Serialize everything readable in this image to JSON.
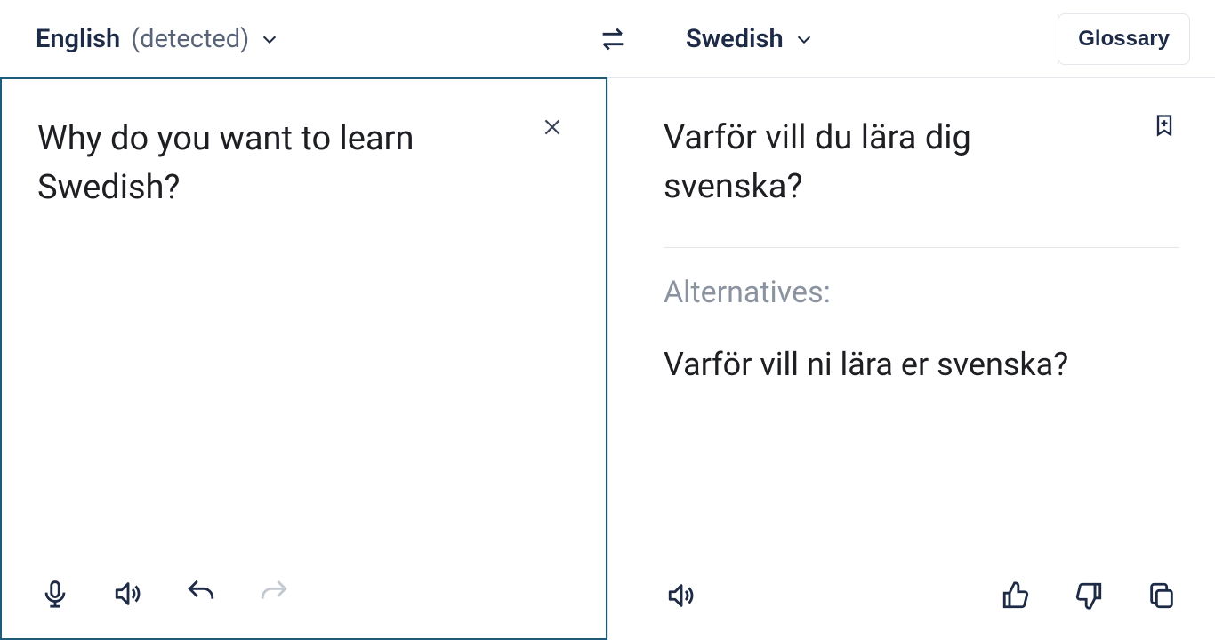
{
  "header": {
    "source_lang": "English",
    "source_suffix": "(detected)",
    "target_lang": "Swedish",
    "glossary_label": "Glossary"
  },
  "source": {
    "text": "Why do you want to learn Swedish?"
  },
  "target": {
    "text": "Varför vill du lära dig svenska?",
    "alternatives_label": "Alternatives:",
    "alternatives": [
      "Varför vill ni lära er svenska?"
    ]
  }
}
